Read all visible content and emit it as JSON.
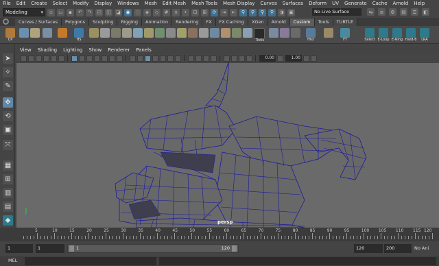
{
  "menubar": {
    "items": [
      "File",
      "Edit",
      "Create",
      "Select",
      "Modify",
      "Display",
      "Windows",
      "Mesh",
      "Edit Mesh",
      "Mesh Tools",
      "Mesh Display",
      "Curves",
      "Surfaces",
      "Deform",
      "UV",
      "Generate",
      "Cache",
      "Arnold",
      "Help"
    ]
  },
  "statusline": {
    "menu_set": "Modeling",
    "live_surface": "No Live Surface"
  },
  "shelf": {
    "tabs": [
      "Curves / Surfaces",
      "Polygons",
      "Sculpting",
      "Rigging",
      "Animation",
      "Rendering",
      "FX",
      "FX Caching",
      "XGen",
      "Arnold",
      "Custom",
      "Tools",
      "TURTLE"
    ],
    "active_tab": "Custom",
    "tool_labels": [
      "CP",
      "HS",
      "Tools",
      "Hist",
      "FT",
      "Select",
      "E-Loop",
      "E-Ring",
      "Hard-8",
      "LRA"
    ]
  },
  "panel": {
    "menus": [
      "View",
      "Shading",
      "Lighting",
      "Show",
      "Renderer",
      "Panels"
    ],
    "field_a": "0.00",
    "field_b": "1.00",
    "camera_label": "persp"
  },
  "timeslider": {
    "ticks": [
      "5",
      "10",
      "15",
      "20",
      "25",
      "30",
      "35",
      "40",
      "45",
      "50",
      "55",
      "60",
      "65",
      "70",
      "75",
      "80",
      "85",
      "90",
      "95",
      "100",
      "105",
      "110",
      "115",
      "120"
    ]
  },
  "rangebar": {
    "start_time": "1",
    "playback_start": "1",
    "range_start_label": "1",
    "range_end_label": "120",
    "playback_end": "120",
    "end_time": "200",
    "anim_layer": "No Ani"
  },
  "cmdline": {
    "label": "MEL"
  },
  "colors": {
    "ui_bg": "#444444",
    "viewport_bg": "#6a6a6a",
    "wireframe": "#1a1aa0",
    "active_tab": "#5d5d5d"
  }
}
